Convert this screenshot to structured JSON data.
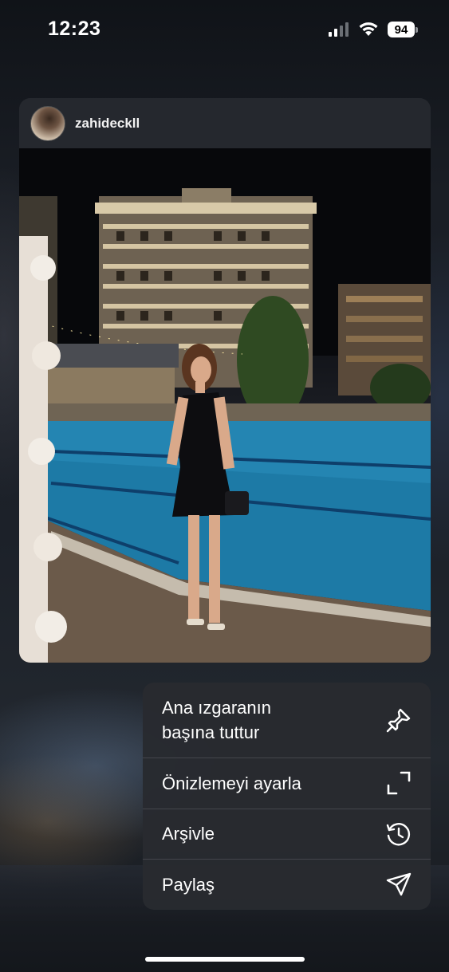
{
  "status_bar": {
    "time": "12:23",
    "battery": "94"
  },
  "post": {
    "username": "zahideckll"
  },
  "menu": {
    "items": [
      {
        "label_line1": "Ana ızgaranın",
        "label_line2": "başına tuttur",
        "icon": "pin-icon"
      },
      {
        "label": "Önizlemeyi ayarla",
        "icon": "expand-icon"
      },
      {
        "label": "Arşivle",
        "icon": "archive-history-icon"
      },
      {
        "label": "Paylaş",
        "icon": "send-icon"
      }
    ]
  }
}
